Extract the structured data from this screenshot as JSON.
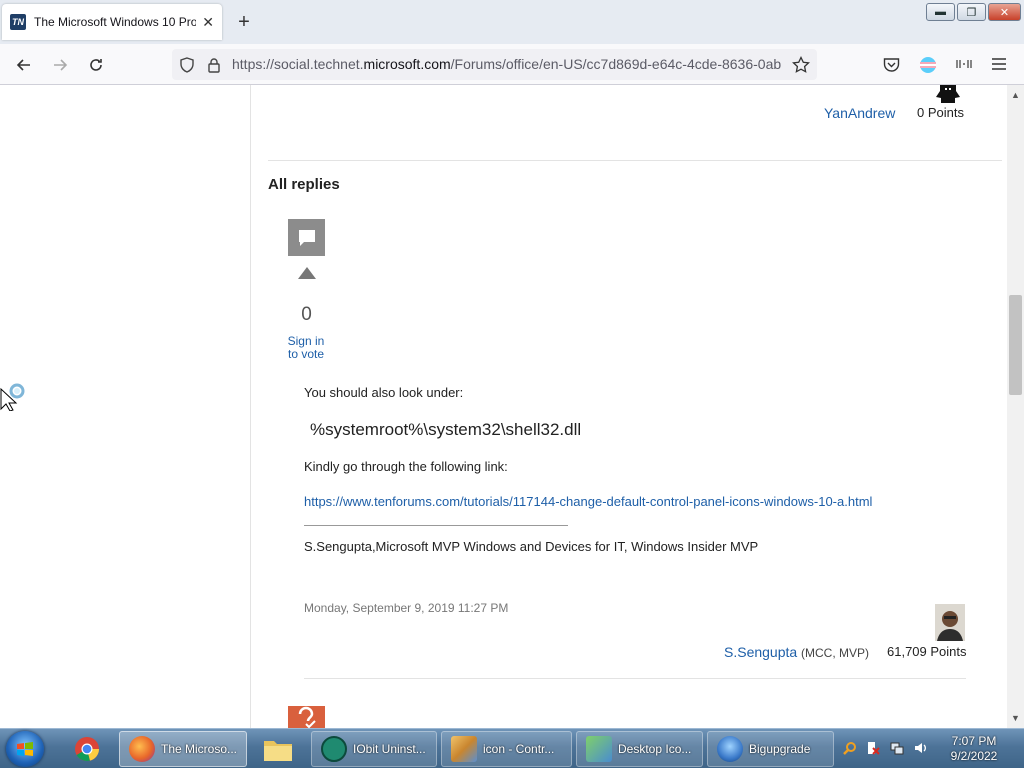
{
  "browser": {
    "tab_title": "The Microsoft Windows 10 Pro",
    "tab_favicon_text": "TN",
    "tab_close": "✕",
    "new_tab": "+",
    "url_prefix": "https://social.technet.",
    "url_host": "microsoft.com",
    "url_path": "/Forums/office/en-US/cc7d869d-e64c-4cde-8636-0ab",
    "window_buttons": {
      "minimize": "▬",
      "maximize": "❐",
      "close": "✕"
    }
  },
  "question_author": {
    "name": "YanAndrew",
    "points": "0 Points"
  },
  "section_title": "All replies",
  "reply": {
    "vote_count": "0",
    "vote_link": "Sign in to vote",
    "line1": "You should also look under:",
    "path": "%systemroot%\\system32\\shell32.dll",
    "line2": "Kindly go through the following link:",
    "link": "https://www.tenforums.com/tutorials/117144-change-default-control-panel-icons-windows-10-a.html",
    "signature": "S.Sengupta,Microsoft MVP Windows and Devices for IT, Windows Insider MVP",
    "date": "Monday, September 9, 2019 11:27 PM",
    "author": "S.Sengupta",
    "badges": "(MCC, MVP)",
    "points": "61,709 Points"
  },
  "taskbar": {
    "items": [
      {
        "label": "The Microso...",
        "icon": "firefox-icon",
        "color": "#e8672a"
      },
      {
        "label": "IObit Uninst...",
        "icon": "iobit-icon",
        "color": "#1f8a70"
      },
      {
        "label": "icon - Contr...",
        "icon": "control-panel-icon",
        "color": "#c9862f"
      },
      {
        "label": "Desktop Ico...",
        "icon": "desktop-icons-icon",
        "color": "#4a8ccf"
      },
      {
        "label": "Bigupgrade",
        "icon": "windows-icon",
        "color": "#3a79c9"
      }
    ],
    "clock_time": "7:07 PM",
    "clock_date": "9/2/2022"
  }
}
